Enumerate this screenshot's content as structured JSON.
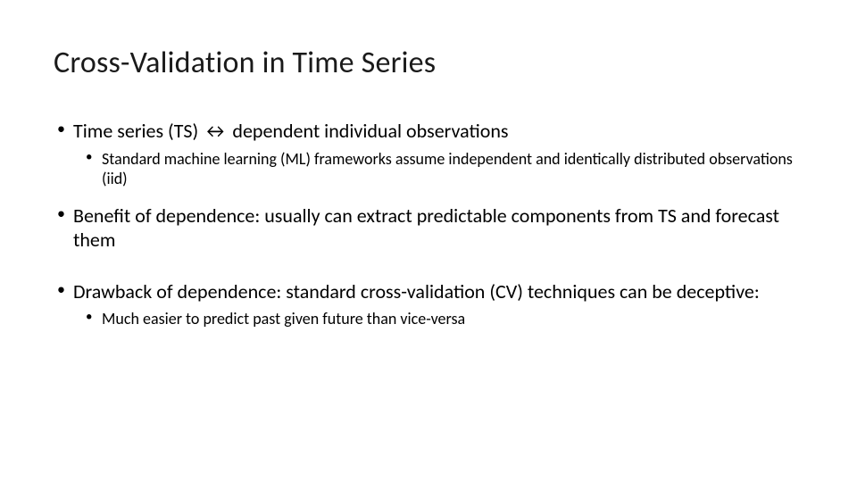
{
  "slide": {
    "title": "Cross-Validation in Time Series",
    "bullets": [
      {
        "text": "Time series (TS) ↔ dependent individual observations",
        "sub": [
          "Standard machine learning (ML) frameworks assume independent and identically distributed observations (iid)"
        ]
      },
      {
        "text": "Benefit of dependence: usually can extract predictable components from TS and forecast them",
        "sub": []
      },
      {
        "text": "Drawback of dependence: standard cross-validation (CV) techniques can be deceptive:",
        "sub": [
          "Much easier to predict past given future than vice-versa"
        ]
      }
    ]
  }
}
